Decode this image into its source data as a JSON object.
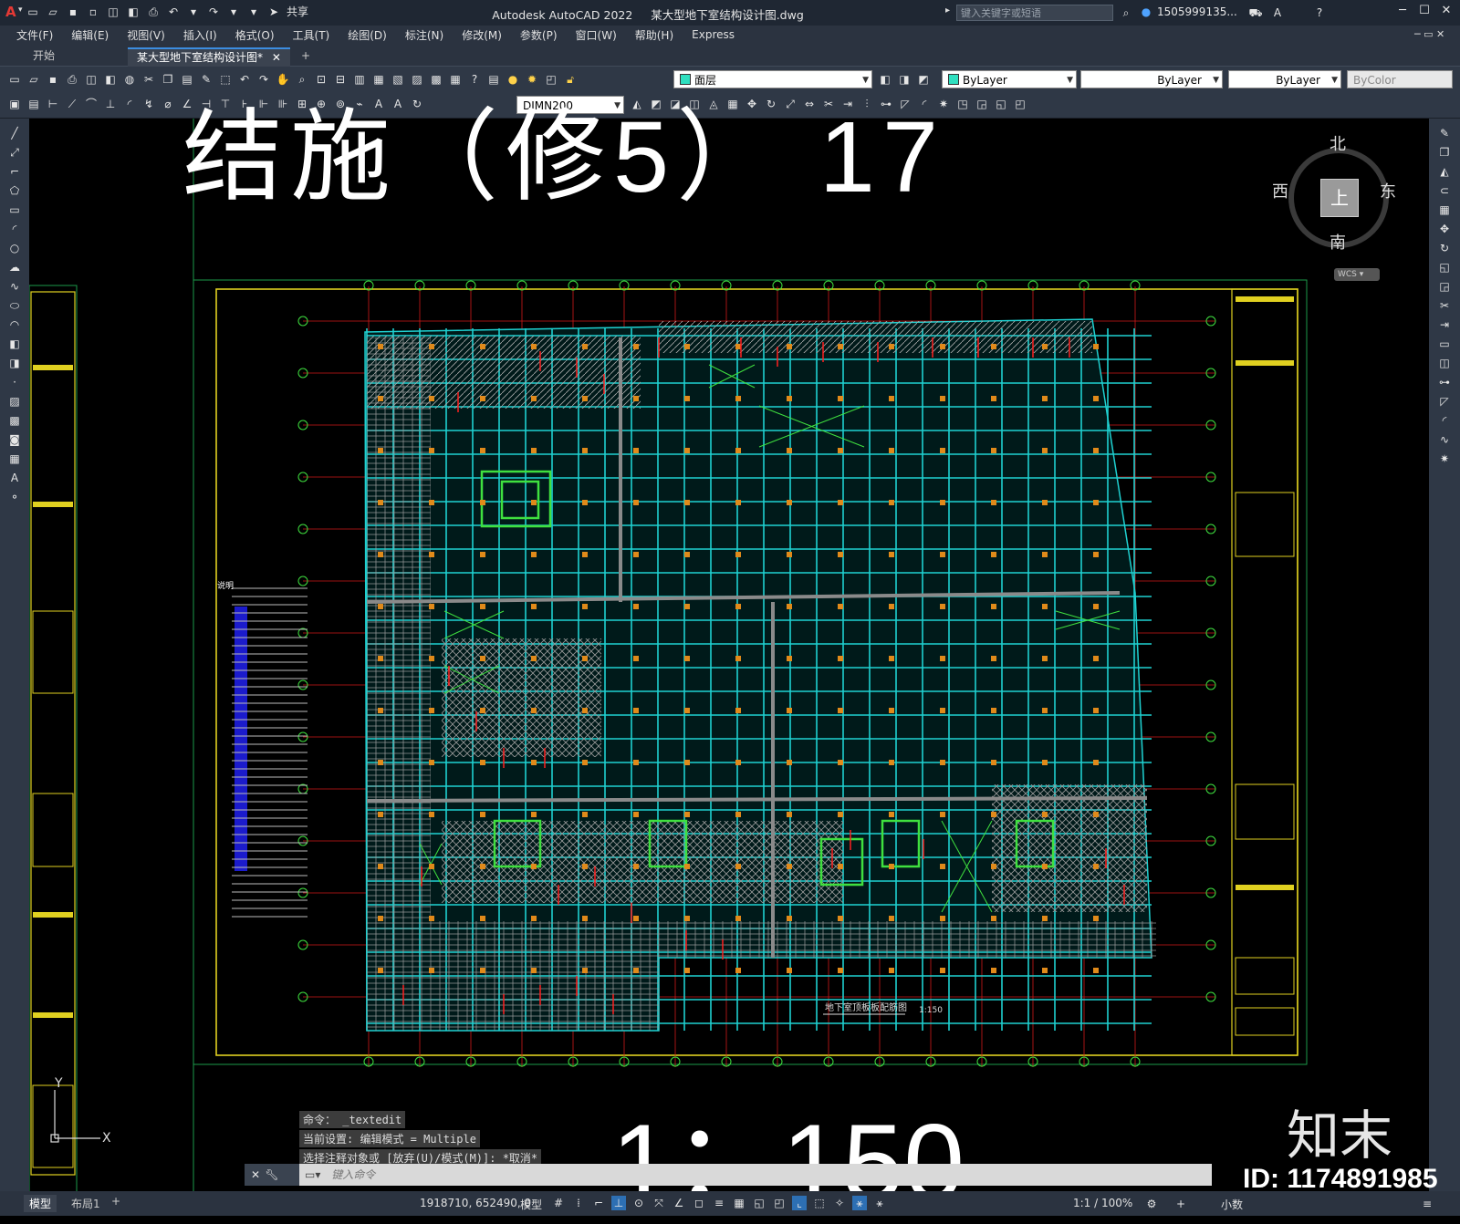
{
  "app": {
    "title": "Autodesk AutoCAD 2022",
    "file": "某大型地下室结构设计图.dwg",
    "share": "共享",
    "search_placeholder": "键入关键字或短语",
    "user": "1505999135..."
  },
  "menu": [
    "文件(F)",
    "编辑(E)",
    "视图(V)",
    "插入(I)",
    "格式(O)",
    "工具(T)",
    "绘图(D)",
    "标注(N)",
    "修改(M)",
    "参数(P)",
    "窗口(W)",
    "帮助(H)",
    "Express"
  ],
  "tabs": {
    "start": "开始",
    "doc": "某大型地下室结构设计图*",
    "add": "+"
  },
  "toolbar": {
    "layer": "面层",
    "color": "ByLayer",
    "linetype": "ByLayer",
    "lineweight": "ByLayer",
    "plotstyle": "ByColor",
    "dimstyle": "DIMN200"
  },
  "compass": {
    "north": "北",
    "south": "南",
    "east": "东",
    "west": "西",
    "center": "上",
    "wcs": "WCS"
  },
  "drawing": {
    "big_title": "结施（修5） 17",
    "plan_title": "地下室顶板板配筋图",
    "plan_scale": "1:150",
    "big_scale": "1：150",
    "notes_header": "说明",
    "ucs_y": "Y",
    "ucs_x": "X"
  },
  "command": {
    "history": [
      "命令： _textedit",
      "当前设置: 编辑模式 = Multiple",
      "选择注释对象或 [放弃(U)/模式(M)]: *取消*"
    ],
    "placeholder": "键入命令"
  },
  "layout_tabs": [
    "模型",
    "布局1",
    "+"
  ],
  "status": {
    "coords": "1918710, 652490, 0",
    "mode": "模型",
    "scale": "1:1 / 100%",
    "units": "小数"
  },
  "watermark": {
    "logo": "知末",
    "id": "ID: 1174891985"
  },
  "colors": {
    "cyan": "#1fd1d1",
    "green": "#3fe03f",
    "red": "#e01818",
    "yellow": "#e0d020",
    "accent": "#3c8de0"
  }
}
